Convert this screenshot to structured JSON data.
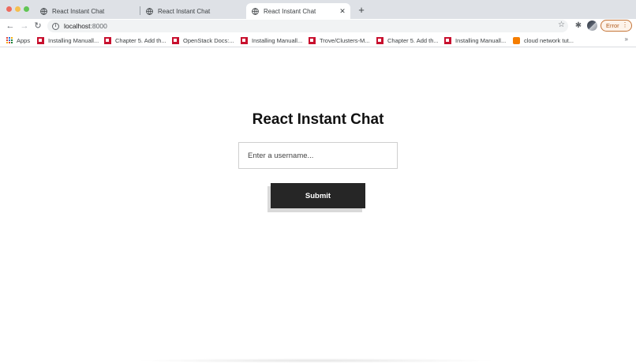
{
  "browser": {
    "tabs": [
      {
        "title": "React Instant Chat",
        "active": false
      },
      {
        "title": "React Instant Chat",
        "active": false
      },
      {
        "title": "React Instant Chat",
        "active": true
      }
    ],
    "new_tab_label": "+",
    "address": {
      "host": "localhost",
      "port": ":8000"
    },
    "error_label": "Error",
    "bookmarks": [
      {
        "label": "Apps",
        "icon": "apps-grid-icon"
      },
      {
        "label": "Installing Manuall...",
        "icon": "redhat-icon"
      },
      {
        "label": "Chapter 5. Add th...",
        "icon": "redhat-icon"
      },
      {
        "label": "OpenStack Docs:...",
        "icon": "redhat-icon"
      },
      {
        "label": "Installing Manuall...",
        "icon": "redhat-icon"
      },
      {
        "label": "Trove/Clusters-M...",
        "icon": "redhat-icon"
      },
      {
        "label": "Chapter 5. Add th...",
        "icon": "redhat-icon"
      },
      {
        "label": "Installing Manuall...",
        "icon": "redhat-icon"
      },
      {
        "label": "cloud network tut...",
        "icon": "blogger-icon"
      }
    ],
    "more_bookmarks": "»"
  },
  "page": {
    "heading": "React Instant Chat",
    "username_placeholder": "Enter a username...",
    "submit_label": "Submit"
  },
  "colors": {
    "tab_strip": "#dee1e6",
    "button_bg": "#262626",
    "button_shadow": "#d9d9d9",
    "error_chip": "#b05a1a"
  }
}
